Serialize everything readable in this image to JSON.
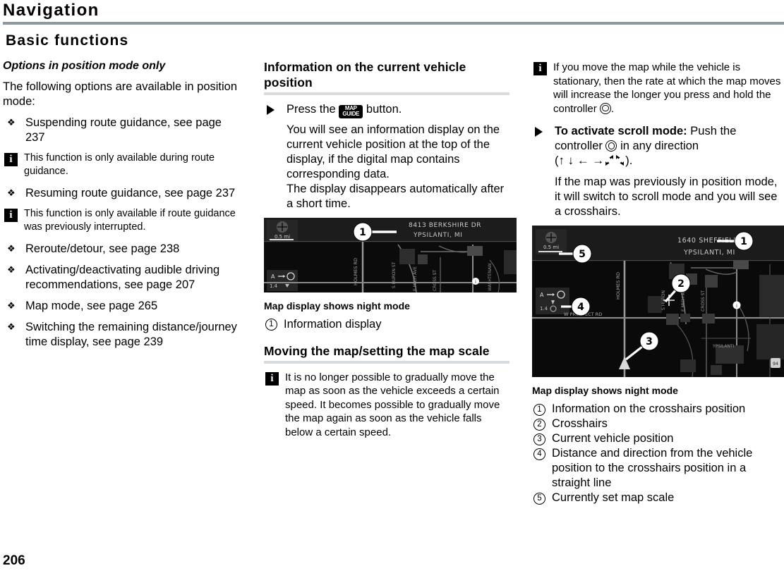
{
  "header": {
    "chapter_title": "Navigation",
    "section_title": "Basic functions",
    "rule_color": "#8b99a0"
  },
  "page_number": "206",
  "col1": {
    "subhead": "Options in position mode only",
    "intro": "The following options are available in position mode:",
    "bullet_glyph": "❖",
    "items": [
      {
        "type": "bullet",
        "text": "Suspending route guidance, see page 237"
      },
      {
        "type": "note",
        "text": "This function is only available during route guidance."
      },
      {
        "type": "bullet",
        "text": "Resuming route guidance, see page 237"
      },
      {
        "type": "note",
        "text": "This function is only available if route guidance was previously interrupted."
      },
      {
        "type": "bullet",
        "text": "Reroute/detour, see page 238"
      },
      {
        "type": "bullet",
        "text": "Activating/deactivating audible driving recommendations, see page 207"
      },
      {
        "type": "bullet",
        "text": "Map mode, see page 265"
      },
      {
        "type": "bullet",
        "text": "Switching the remaining distance/journey time display, see page 239"
      }
    ]
  },
  "col2": {
    "heading": "Information on the current vehicle position",
    "step_press_prefix": "Press the",
    "mapguide_button": {
      "line1": "MAP",
      "line2": "GUIDE"
    },
    "step_press_suffix": "button.",
    "para1": "You will see an information display on the current vehicle position at the top of the display, if the digital map contains corresponding data.",
    "para2": "The display disappears automatically after a short time.",
    "map": {
      "address_line1": "8413 BERKSHIRE DR",
      "address_line2": "YPSILANTI, MI",
      "scale_label": "0.5 mi",
      "street_labels": [
        "HOLMES RD",
        "S HURON ST",
        "CROSS ST",
        "MICHIGAN AVE"
      ],
      "callouts": [
        "1"
      ]
    },
    "map_caption": "Map display shows night mode",
    "legend": [
      {
        "num": "1",
        "text": "Information display"
      }
    ],
    "heading2": "Moving the map/setting the map scale",
    "note": "It is no longer possible to gradually move the map as soon as the vehicle exceeds a certain speed. It becomes possible to gradually move the map again as soon as the vehicle falls below a certain speed."
  },
  "col3": {
    "note": "If you move the map while the vehicle is stationary, then the rate at which the map moves will increase the longer you press and hold the controller",
    "note_tail": ".",
    "step_bold": "To activate scroll mode:",
    "step_text_1": "Push the controller",
    "step_text_2": "in any direction",
    "arrows": [
      "↑",
      "↓",
      "←",
      "→",
      "diag-ne-sw",
      "diag-nw-se"
    ],
    "para": "If the map was previously in position mode, it will switch to scroll mode and you will see a crosshairs.",
    "map": {
      "address_line1": "1640 SHEFFIELD DR",
      "address_line2": "YPSILANTI, MI",
      "scale_label": "0.5 mi",
      "street_labels": [
        "HOLMES RD",
        "E MICHIGAN AVE",
        "CROSS ST",
        "S HURON ST",
        "W PROSPECT RD"
      ],
      "callouts": [
        "1",
        "2",
        "3",
        "4",
        "5"
      ]
    },
    "map_caption": "Map display shows night mode",
    "legend": [
      {
        "num": "1",
        "text": "Information on the crosshairs position"
      },
      {
        "num": "2",
        "text": "Crosshairs"
      },
      {
        "num": "3",
        "text": "Current vehicle position"
      },
      {
        "num": "4",
        "text": "Distance and direction from the vehicle position to the crosshairs position in a straight line"
      },
      {
        "num": "5",
        "text": "Currently set map scale"
      }
    ]
  }
}
